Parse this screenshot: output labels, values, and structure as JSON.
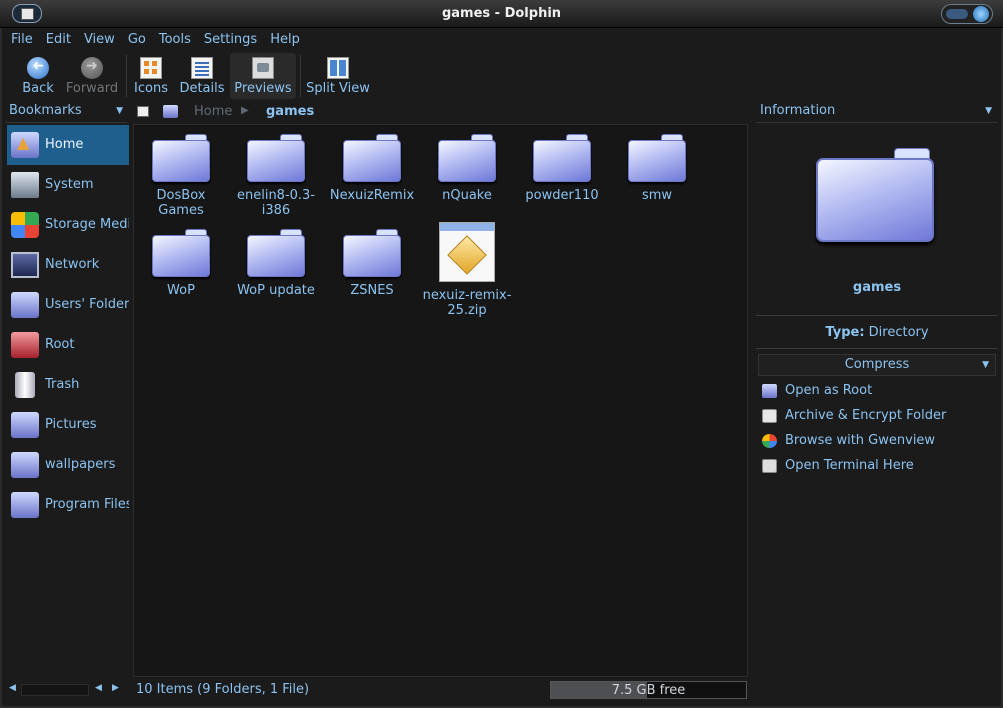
{
  "window": {
    "title": "games - Dolphin"
  },
  "menu": [
    "File",
    "Edit",
    "View",
    "Go",
    "Tools",
    "Settings",
    "Help"
  ],
  "toolbar": {
    "back": "Back",
    "forward": "Forward",
    "icons": "Icons",
    "details": "Details",
    "previews": "Previews",
    "split_view": "Split View"
  },
  "bookmarks": {
    "header": "Bookmarks",
    "items": [
      {
        "label": "Home",
        "icon": "home-folder-icon"
      },
      {
        "label": "System",
        "icon": "system-icon"
      },
      {
        "label": "Storage Media",
        "icon": "storage-media-icon"
      },
      {
        "label": "Network",
        "icon": "network-icon"
      },
      {
        "label": "Users' Folders",
        "icon": "users-folder-icon"
      },
      {
        "label": "Root",
        "icon": "root-folder-icon"
      },
      {
        "label": "Trash",
        "icon": "trash-icon"
      },
      {
        "label": "Pictures",
        "icon": "pictures-folder-icon"
      },
      {
        "label": "wallpapers",
        "icon": "wallpapers-folder-icon"
      },
      {
        "label": "Program Files",
        "icon": "program-files-folder-icon"
      }
    ]
  },
  "breadcrumb": {
    "home": "Home",
    "current": "games"
  },
  "files": [
    {
      "name": "DosBox\nGames",
      "type": "folder"
    },
    {
      "name": "enelin8-0.3-\ni386",
      "type": "folder"
    },
    {
      "name": "NexuizRemix",
      "type": "folder"
    },
    {
      "name": "nQuake",
      "type": "folder"
    },
    {
      "name": "powder110",
      "type": "folder"
    },
    {
      "name": "smw",
      "type": "folder"
    },
    {
      "name": "WoP",
      "type": "folder"
    },
    {
      "name": "WoP update",
      "type": "folder"
    },
    {
      "name": "ZSNES",
      "type": "folder"
    },
    {
      "name": "nexuiz-remix-\n25.zip",
      "type": "zip"
    }
  ],
  "info": {
    "header": "Information",
    "name": "games",
    "type_label": "Type:",
    "type_value": "Directory",
    "compress": "Compress",
    "actions": [
      {
        "label": "Open as Root",
        "icon": "root-folder-icon"
      },
      {
        "label": "Archive & Encrypt Folder",
        "icon": "archive-icon"
      },
      {
        "label": "Browse with Gwenview",
        "icon": "gwenview-icon"
      },
      {
        "label": "Open Terminal Here",
        "icon": "terminal-icon"
      }
    ]
  },
  "status": {
    "items": "10 Items (9 Folders, 1 File)",
    "free_space": "7.5 GB free",
    "used_fraction": 0.49
  },
  "colors": {
    "accent": "#8cc3f0",
    "selection": "#1e5f8e",
    "background": "#1b1b1b"
  }
}
